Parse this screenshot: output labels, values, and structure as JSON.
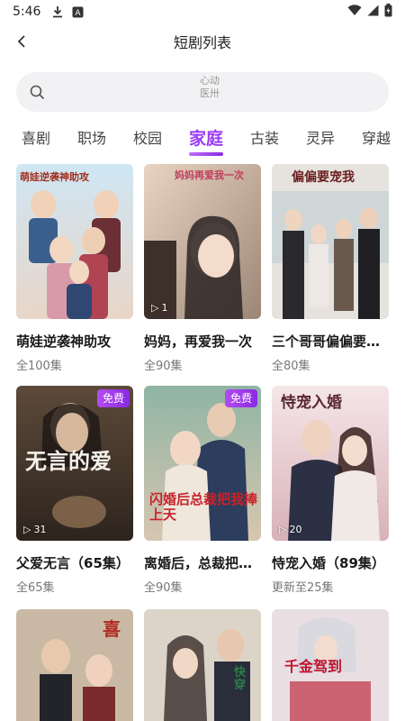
{
  "status_bar": {
    "time": "5:46",
    "icons": [
      "download-icon",
      "a-badge-icon",
      "wifi-icon",
      "signal-icon",
      "battery-icon"
    ]
  },
  "header": {
    "title": "短剧列表",
    "back_icon": "chevron-left-icon"
  },
  "search": {
    "placeholder_line1": "心动",
    "placeholder_line2": "医卅"
  },
  "tabs": [
    {
      "label": "喜剧",
      "active": false
    },
    {
      "label": "职场",
      "active": false
    },
    {
      "label": "校园",
      "active": false
    },
    {
      "label": "家庭",
      "active": true
    },
    {
      "label": "古装",
      "active": false
    },
    {
      "label": "灵异",
      "active": false
    },
    {
      "label": "穿越",
      "active": false
    }
  ],
  "colors": {
    "accent": "#9b3cf5",
    "badge": "#8a2be2",
    "search_bg": "#f2f2f4"
  },
  "dramas": [
    {
      "title": "萌娃逆袭神助攻",
      "episodes": "全100集",
      "badge": "",
      "plays": "",
      "poster_text": "萌娃逆袭神助攻"
    },
    {
      "title": "妈妈，再爱我一次",
      "episodes": "全90集",
      "badge": "",
      "plays": "1",
      "poster_text": "妈妈再爱我一次"
    },
    {
      "title": "三个哥哥偏偏要宠我",
      "episodes": "全80集",
      "badge": "",
      "plays": "",
      "poster_text": "偏偏要宠我"
    },
    {
      "title": "父爱无言（65集）",
      "episodes": "全65集",
      "badge": "免费",
      "plays": "31",
      "poster_text": "无言的爱"
    },
    {
      "title": "离婚后，总裁把我捧上天",
      "episodes": "全90集",
      "badge": "免费",
      "plays": "",
      "poster_text": "闪婚后总裁把我捧上天"
    },
    {
      "title": "恃宠入婚（89集）",
      "episodes": "更新至25集",
      "badge": "",
      "plays": "20",
      "poster_text": "恃宠入婚"
    },
    {
      "title": "",
      "episodes": "",
      "badge": "",
      "plays": "",
      "poster_text": "喜"
    },
    {
      "title": "",
      "episodes": "",
      "badge": "",
      "plays": "",
      "poster_text": "快穿"
    },
    {
      "title": "",
      "episodes": "",
      "badge": "",
      "plays": "",
      "poster_text": "千金驾到"
    }
  ]
}
